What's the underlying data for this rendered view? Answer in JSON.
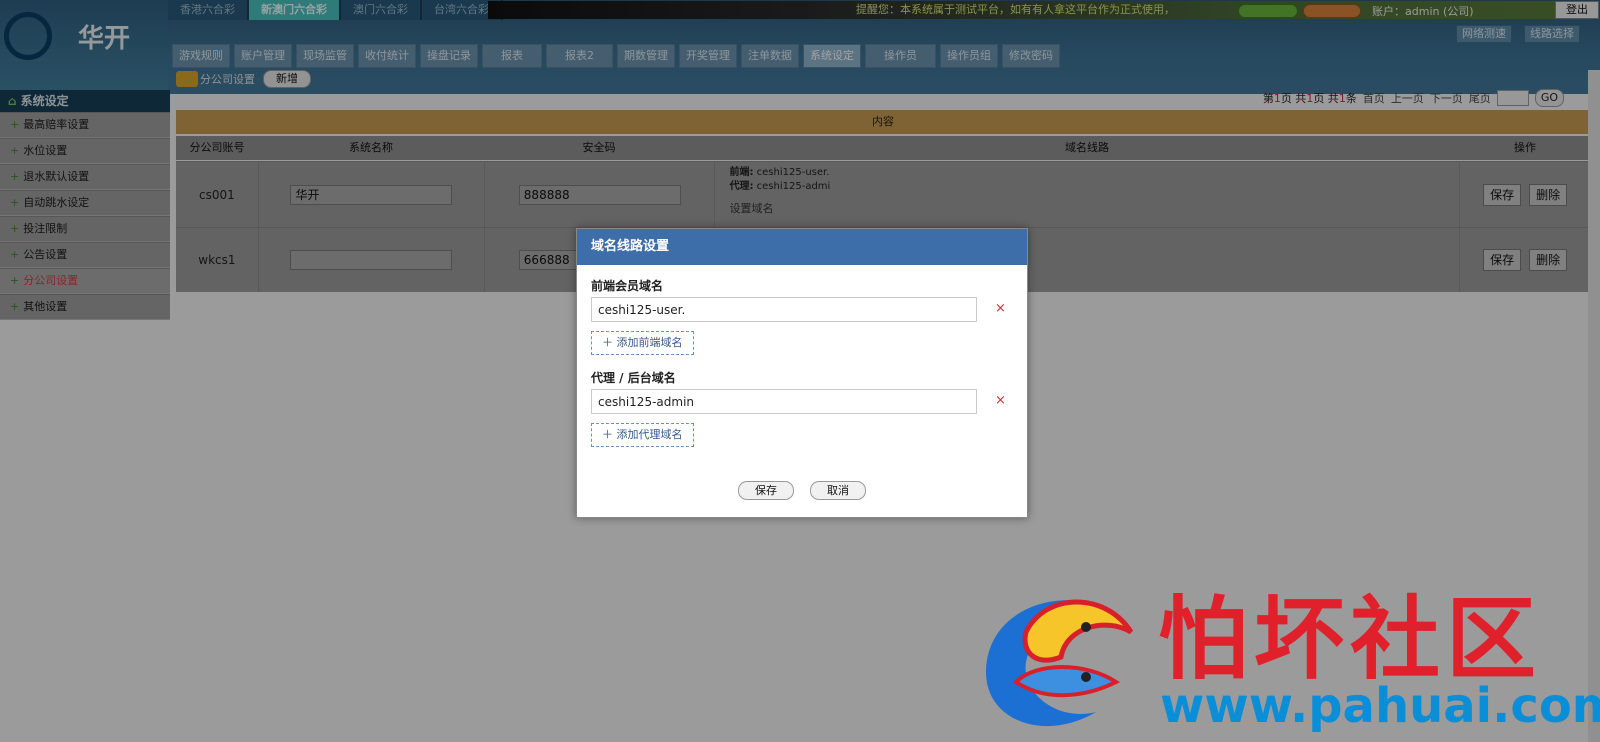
{
  "header": {
    "logo_text": "华开",
    "game_tabs": [
      "香港六合彩",
      "新澳门六合彩",
      "澳门六合彩",
      "台湾六合彩"
    ],
    "marquee": "提醒您：本系统属于测试平台，如有有人拿这平台作为正式使用，",
    "account": "账户：admin (公司)",
    "logout": "登出",
    "mini_buttons": [
      "网络测速",
      "线路选择"
    ],
    "nav": [
      "游戏规则",
      "账户管理",
      "现场监管",
      "收付统计",
      "操盘记录",
      "报表",
      "报表2",
      "期数管理",
      "开奖管理",
      "注单数据",
      "系统设定",
      "操作员",
      "操作员组",
      "修改密码"
    ],
    "active_nav": "系统设定",
    "sub_title": "分公司设置",
    "new_button": "新增"
  },
  "sidebar": {
    "title": "系统设定",
    "items": [
      "最高赔率设置",
      "水位设置",
      "退水默认设置",
      "自动跳水设定",
      "投注限制",
      "公告设置",
      "分公司设置",
      "其他设置"
    ],
    "active_item": "分公司设置"
  },
  "pager": {
    "prefix": "第",
    "page": "1",
    "mid1": "页 共",
    "total_pages": "1",
    "mid2": "页 共",
    "total_items": "1",
    "suffix": "条",
    "first": "首页",
    "prev": "上一页",
    "next": "下一页",
    "last": "尾页",
    "go": "GO"
  },
  "table": {
    "header_bar": "内容",
    "columns": [
      "分公司账号",
      "系统名称",
      "安全码",
      "域名线路",
      "操作"
    ],
    "rows": [
      {
        "account": "cs001",
        "name": "华开",
        "code": "888888",
        "front_label": "前端:",
        "front_value": "ceshi125-user.",
        "agent_label": "代理:",
        "agent_value": "ceshi125-admi",
        "set_domain": "设置域名",
        "save": "保存",
        "delete": "删除"
      },
      {
        "account": "wkcs1",
        "name": "",
        "code": "666888",
        "save": "保存",
        "delete": "删除"
      }
    ]
  },
  "modal": {
    "title": "域名线路设置",
    "front_label": "前端会员域名",
    "front_value": "ceshi125-user.",
    "add_front": "＋ 添加前端域名",
    "agent_label": "代理 / 后台域名",
    "agent_value": "ceshi125-admin",
    "add_agent": "＋ 添加代理域名",
    "delete_glyph": "×",
    "save": "保存",
    "cancel": "取消"
  },
  "watermark": {
    "text": "怕坏社区",
    "url": "www.pahuai.com"
  }
}
